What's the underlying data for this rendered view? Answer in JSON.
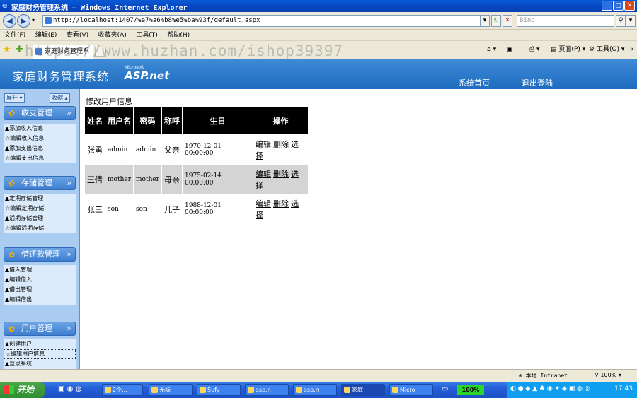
{
  "window": {
    "title": "家庭财务管理系统 — Windows Internet Explorer"
  },
  "address": {
    "url": "http://localhost:1407/%e7%a6%b8%e5%ba%93f/default.aspx",
    "search_placeholder": "Bing"
  },
  "menu": [
    "文件(F)",
    "编辑(E)",
    "查看(V)",
    "收藏夹(A)",
    "工具(T)",
    "帮助(H)"
  ],
  "tab": {
    "label": "家庭财务管理系统"
  },
  "commands": {
    "page": "页面(P)",
    "tools": "工具(O)"
  },
  "watermark": "https://www.huzhan.com/ishop39397",
  "header": {
    "app_title": "家庭财务管理系统",
    "brand_small": "Microsoft",
    "brand": "ASP.net",
    "nav_home": "系统首页",
    "nav_logout": "退出登陆"
  },
  "sidebar": {
    "expand": "展开",
    "collapse": "收缩",
    "sections": [
      {
        "title": "收支管理",
        "items": [
          "▲添加收入信息",
          "☆编辑收入信息",
          "▲添加支出信息",
          "☆编辑支出信息"
        ]
      },
      {
        "title": "存储管理",
        "items": [
          "▲定期存储管理",
          "☆编辑定期存储",
          "▲活期存储管理",
          "☆编辑活期存储"
        ]
      },
      {
        "title": "借还款管理",
        "items": [
          "▲借入管理",
          "▲编辑借入",
          "▲借出管理",
          "▲编辑借出"
        ]
      },
      {
        "title": "用户管理",
        "items": [
          "▲创建用户",
          "☆编辑用户信息",
          "▲登录系统"
        ]
      }
    ]
  },
  "content": {
    "caption": "修改用户信息",
    "headers": [
      "姓名",
      "用户名",
      "密码",
      "称呼",
      "生日",
      "操作"
    ],
    "rows": [
      {
        "name": "张勇",
        "username": "admin",
        "password": "admin",
        "title": "父亲",
        "birthday": "1970-12-01 00:00:00"
      },
      {
        "name": "王倩",
        "username": "mother",
        "password": "mother",
        "title": "母亲",
        "birthday": "1975-02-14 00:00:00"
      },
      {
        "name": "张三",
        "username": "son",
        "password": "son",
        "title": "儿子",
        "birthday": "1988-12-01 00:00:00"
      }
    ],
    "actions": {
      "edit": "编辑",
      "delete": "删除",
      "select": "选择"
    }
  },
  "status": {
    "zone": "本地 Intranet",
    "zoom": "100%"
  },
  "taskbar": {
    "start": "开始",
    "buttons": [
      "2个...",
      "无标",
      "Sufy",
      "asp.n",
      "asp.n",
      "家庭",
      "Micro"
    ],
    "meter": "100%",
    "clock": "17:43"
  }
}
